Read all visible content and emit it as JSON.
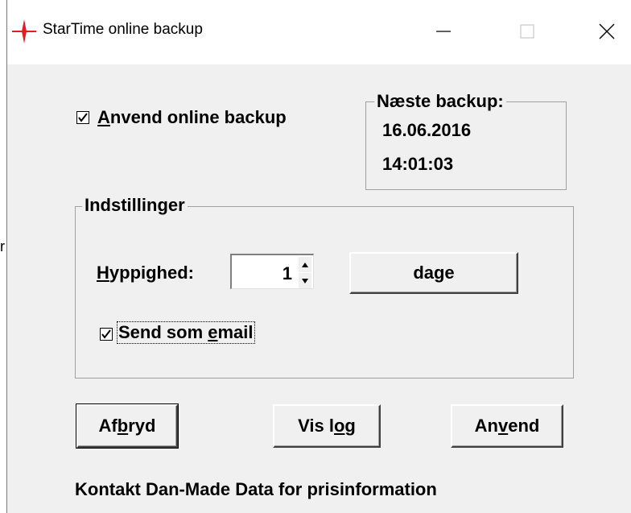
{
  "stray_text": "r",
  "window": {
    "title": "StarTime online backup",
    "min_icon": "minimize-icon",
    "max_icon": "maximize-icon",
    "close_icon": "close-icon"
  },
  "online": {
    "checked": true,
    "label_accel": "A",
    "label_rest": "nvend online backup"
  },
  "next_backup": {
    "legend": "Næste backup:",
    "date": "16.06.2016",
    "time": "14:01:03"
  },
  "settings": {
    "legend": "Indstillinger",
    "freq_label_accel": "H",
    "freq_label_rest": "yppighed:",
    "freq_value": "1",
    "unit_button": "dage",
    "email_checked": true,
    "email_label_pre": "Send som ",
    "email_label_accel": "e",
    "email_label_post": "mail"
  },
  "buttons": {
    "cancel_pre": "Af",
    "cancel_accel": "b",
    "cancel_post": "ryd",
    "log_pre": "Vis l",
    "log_accel": "o",
    "log_post": "g",
    "apply_pre": "An",
    "apply_accel": "v",
    "apply_post": "end"
  },
  "footer": "Kontakt Dan-Made Data for prisinformation"
}
